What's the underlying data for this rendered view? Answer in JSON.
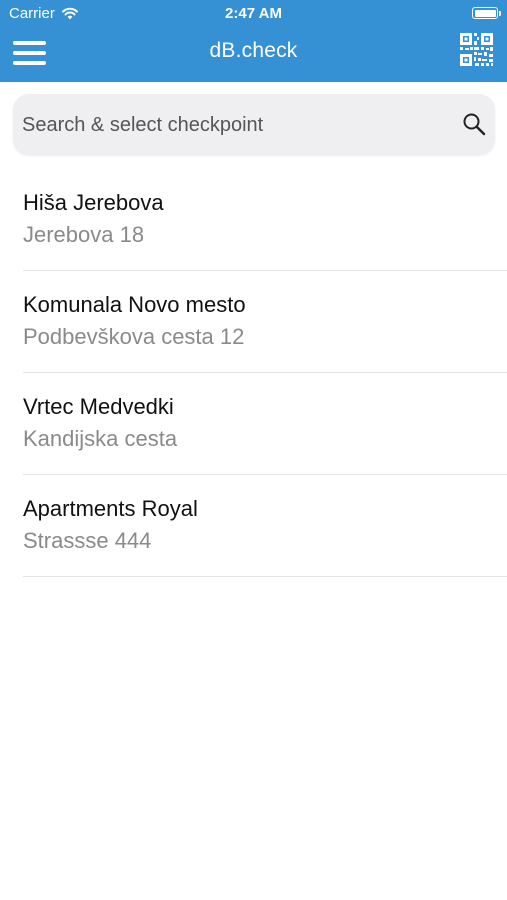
{
  "status_bar": {
    "carrier": "Carrier",
    "time": "2:47 AM"
  },
  "header": {
    "title": "dB.check",
    "background_color": "#3590D4"
  },
  "search": {
    "placeholder": "Search & select checkpoint",
    "value": ""
  },
  "checkpoints": [
    {
      "name": "Hiša Jerebova",
      "address": "Jerebova 18"
    },
    {
      "name": "Komunala Novo mesto",
      "address": "Podbevškova cesta 12"
    },
    {
      "name": "Vrtec Medvedki",
      "address": "Kandijska cesta"
    },
    {
      "name": "Apartments Royal",
      "address": "Strassse 444"
    }
  ],
  "icons": {
    "menu": "hamburger-menu-icon",
    "qr": "qr-code-icon",
    "search": "search-icon",
    "wifi": "wifi-icon",
    "battery": "battery-icon"
  }
}
